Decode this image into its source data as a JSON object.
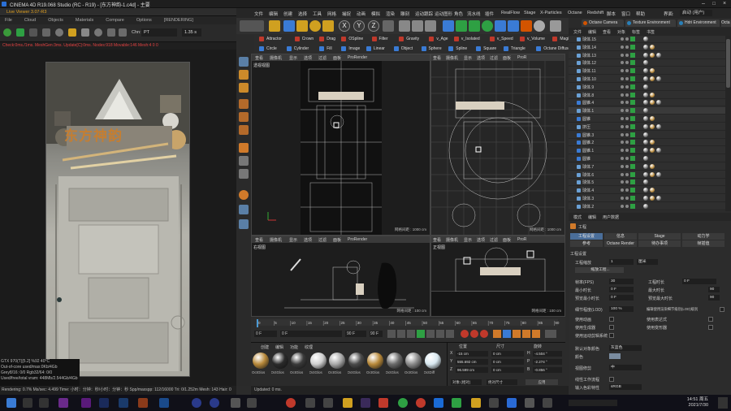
{
  "titlebar": {
    "title": "CINEMA 4D R19.068 Studio (RC - R19) - [东方神韵-1.c4d] - 主要"
  },
  "live_viewer": {
    "title": "Live Viewer 3.07-R3",
    "menu": [
      "File",
      "Cloud",
      "Objects",
      "Materials",
      "Compare",
      "Options",
      "[RENDERING]"
    ],
    "channel_label": "Chn:",
    "channel_value": "PT",
    "exposure_value": "1.35 s",
    "status": "Check:0ms./1ms. MeshGen:3ms. Update[C]:0ms. Nodes:918 Movable:146  Mesh:4  0  0",
    "image_title": "东方神韵",
    "gpu_stats": [
      "GTX 970(T)[5.2]          %92     40°C",
      "Out-of-core used/max:0Kb/4Gb",
      "Grey8/16: 0/0         Rgb32/64: 0/0",
      "Used/free/total vram: 448Mb/2.544Gb/4Gb"
    ],
    "bottom_status": "Rendering: 0.7%   Ms/sec: 4.499   Time: 小时：分钟：秒/小时：分钟：秒   Spp/maxspp: 112/16000   Tri: 0/1.252m   Mesh: 143   Hair: 0"
  },
  "menubar": [
    "文件",
    "编辑",
    "创建",
    "选择",
    "工具",
    "网格",
    "捕捉",
    "动画",
    "模拟",
    "渲染",
    "雕刻",
    "运动跟踪",
    "运动图形",
    "角色",
    "流水线",
    "插件",
    "RealFlow",
    "Stage",
    "X-Particles",
    "Octane",
    "Redshift",
    "脚本",
    "窗口",
    "帮助"
  ],
  "interface": {
    "label": "界面:",
    "value": "启动 (用户)"
  },
  "toolbar_tags_1": [
    {
      "label": "Attractor",
      "color": "#c0392b"
    },
    {
      "label": "Crown",
      "color": "#c0392b"
    },
    {
      "label": "Drag",
      "color": "#c0392b"
    },
    {
      "label": "OSpline",
      "color": "#c0392b"
    },
    {
      "label": "Filter",
      "color": "#c0392b"
    },
    {
      "label": "Gravity",
      "color": "#c0392b"
    },
    {
      "label": "v_Age",
      "color": "#c0392b"
    },
    {
      "label": "v_Isolated",
      "color": "#c0392b"
    },
    {
      "label": "v_Speed",
      "color": "#c0392b"
    },
    {
      "label": "v_Volume",
      "color": "#c0392b"
    },
    {
      "label": "Magic",
      "color": "#c0392b"
    }
  ],
  "toolbar_tags_2": [
    {
      "label": "Circle",
      "color": "#3a7bd5"
    },
    {
      "label": "Cylinder",
      "color": "#3a7bd5"
    },
    {
      "label": "Fill",
      "color": "#3a7bd5"
    },
    {
      "label": "Image",
      "color": "#3a7bd5"
    },
    {
      "label": "Linear",
      "color": "#3a7bd5"
    },
    {
      "label": "Object",
      "color": "#3a7bd5"
    },
    {
      "label": "Sphere",
      "color": "#3a7bd5"
    },
    {
      "label": "Spline",
      "color": "#3a7bd5"
    },
    {
      "label": "Square",
      "color": "#3a7bd5"
    },
    {
      "label": "Triangle",
      "color": "#3a7bd5"
    },
    {
      "label": "Octane Diffuse Material",
      "color": "#3a7bd5"
    }
  ],
  "viewports": {
    "menu": [
      "查看",
      "摄像机",
      "显示",
      "选项",
      "过滤",
      "面板",
      "ProRender"
    ],
    "menu_short": [
      "查看",
      "摄像机",
      "显示",
      "选项",
      "过滤",
      "面板",
      "ProR"
    ],
    "perspective_label": "透视视图",
    "right_label": "右视图",
    "front_label": "正视图",
    "grid_1000": "网格间距 : 1000 cm",
    "grid_100": "网格间距 : 100 cm"
  },
  "timeline": {
    "ticks": [
      "0",
      "5",
      "10",
      "15",
      "20",
      "25",
      "30",
      "35",
      "40",
      "45",
      "50",
      "55",
      "60",
      "65",
      "70",
      "75",
      "80",
      "85",
      "90"
    ],
    "start_frame": "0 F",
    "current_frame": "0 F",
    "end_frame": "90 F",
    "end_frame2": "90 F"
  },
  "materials": {
    "menu": [
      "创建",
      "编辑",
      "功能",
      "纹理"
    ],
    "items": [
      "OctGlos",
      "OctGlos",
      "OctGlos",
      "OctGlos",
      "OctGlos",
      "OctGlos",
      "OctGlos",
      "OctGlos",
      "OctGlos",
      "OctDiff"
    ]
  },
  "coordinates": {
    "headers": [
      "位置",
      "尺寸",
      "旋转"
    ],
    "rows": [
      {
        "axis": "X",
        "pos": "-15 cm",
        "size": "0 cm",
        "rot_label": "H",
        "rot": "-4.504 °"
      },
      {
        "axis": "Y",
        "pos": "555.692 cm",
        "size": "0 cm",
        "rot_label": "P",
        "rot": "-2.274 °"
      },
      {
        "axis": "Z",
        "pos": "96.599 cm",
        "size": "0 cm",
        "rot_label": "B",
        "rot": "-0.856 °"
      }
    ],
    "mode": "对象 (相对)",
    "size_mode": "绝对尺寸",
    "apply": "应用"
  },
  "object_manager": {
    "tabs": [
      {
        "label": "Octane Camera",
        "color": "#d35400"
      },
      {
        "label": "Texture Environment",
        "color": "#2980b9"
      },
      {
        "label": "Hdri Environment",
        "color": "#2980b9"
      },
      {
        "label": "Octa",
        "color": "#2980b9"
      }
    ],
    "menu": [
      "文件",
      "编辑",
      "查看",
      "对象",
      "标签",
      "书签"
    ],
    "rows": [
      "球体.15",
      "球体.14",
      "球体.13",
      "球体.12",
      "球体.11",
      "球体.10",
      "球体.9",
      "球体.8",
      "圆锥.4",
      "球体.1",
      "圆锥",
      "挤压",
      "圆锥.3",
      "圆锥.2",
      "圆锥.1",
      "圆锥",
      "球体.7",
      "球体.6",
      "球体.5",
      "球体.4",
      "球体.3",
      "球体.2"
    ]
  },
  "attributes": {
    "menu": [
      "模式",
      "编辑",
      "用户数据"
    ],
    "header": "工程",
    "tabs_row1": [
      "工程设置",
      "信息",
      "Stage",
      "动力学"
    ],
    "tabs_row2": [
      "参考",
      "Octane Render",
      "待办事项",
      "帧插值"
    ],
    "section": "工程设置",
    "scale_label": "工程缩放",
    "scale_value": "1",
    "scale_unit": "厘米",
    "scale_button": "缩放工程...",
    "fps_label": "帧率(FPS)",
    "fps_value": "30",
    "project_time_label": "工程时长",
    "project_time_value": "0 F",
    "min_time_label": "最小时长",
    "min_time_value": "0 F",
    "max_time_label": "最大时长",
    "max_time_value": "90",
    "preview_min_label": "预览最小时长",
    "preview_min_value": "0 F",
    "preview_max_label": "预览最大时长",
    "preview_max_value": "90",
    "lod_label": "细节程度(LOD)",
    "lod_value": "100 %",
    "lod_check_label": "编辑使用渲染细节级别(LOD)级别",
    "anim_label": "使用动画",
    "expr_label": "使用表达式",
    "gen_label": "使用生成器",
    "deform_label": "使用变形器",
    "motion_label": "使用运动剪辑系统",
    "default_color_label": "默认对象颜色",
    "default_color_value": "灰蓝色",
    "color_label": "颜色",
    "view_clip_label": "视图修剪",
    "view_clip_value": "中",
    "linear_label": "线性工作流程",
    "input_color_label": "输入色彩特性",
    "input_color_value": "sRGB"
  },
  "c4d_status": "Updated: 0 ms.",
  "taskbar": {
    "time": "14:51 周五",
    "date": "2021/7/30"
  }
}
